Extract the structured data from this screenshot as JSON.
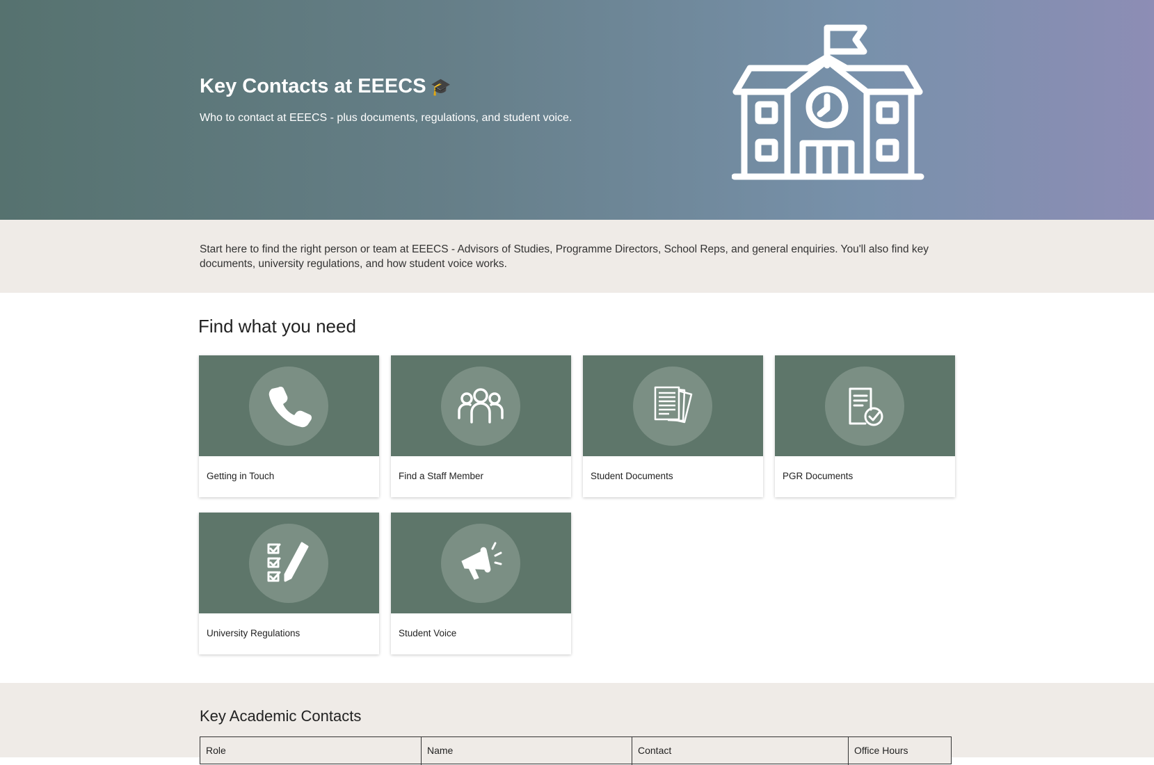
{
  "hero": {
    "title": "Key Contacts at EEECS",
    "title_emoji": "🎓",
    "subtitle": "Who to contact at EEECS - plus documents, regulations, and student voice.",
    "illustration": "school-building-icon"
  },
  "intro": {
    "text": "Start here to find the right person or team at EEECS - Advisors of Studies, Programme Directors, School Reps, and general enquiries. You'll also find key documents, university regulations, and how student voice works."
  },
  "quicklinks": {
    "heading": "Find what you need",
    "tiles": [
      {
        "label": "Getting in Touch",
        "icon": "phone-icon"
      },
      {
        "label": "Find a Staff Member",
        "icon": "people-group-icon"
      },
      {
        "label": "Student Documents",
        "icon": "documents-icon"
      },
      {
        "label": "PGR Documents",
        "icon": "document-check-icon"
      },
      {
        "label": "University Regulations",
        "icon": "checklist-pencil-icon"
      },
      {
        "label": "Student Voice",
        "icon": "megaphone-icon"
      }
    ]
  },
  "contacts": {
    "heading": "Key Academic Contacts",
    "columns": [
      "Role",
      "Name",
      "Contact",
      "Office Hours"
    ]
  },
  "colors": {
    "tile_header": "#5e766a",
    "tile_circle": "#7b8f84",
    "section_band": "#efebe7",
    "hero_gradient_start": "#56726f",
    "hero_gradient_end": "#8d8db5"
  }
}
